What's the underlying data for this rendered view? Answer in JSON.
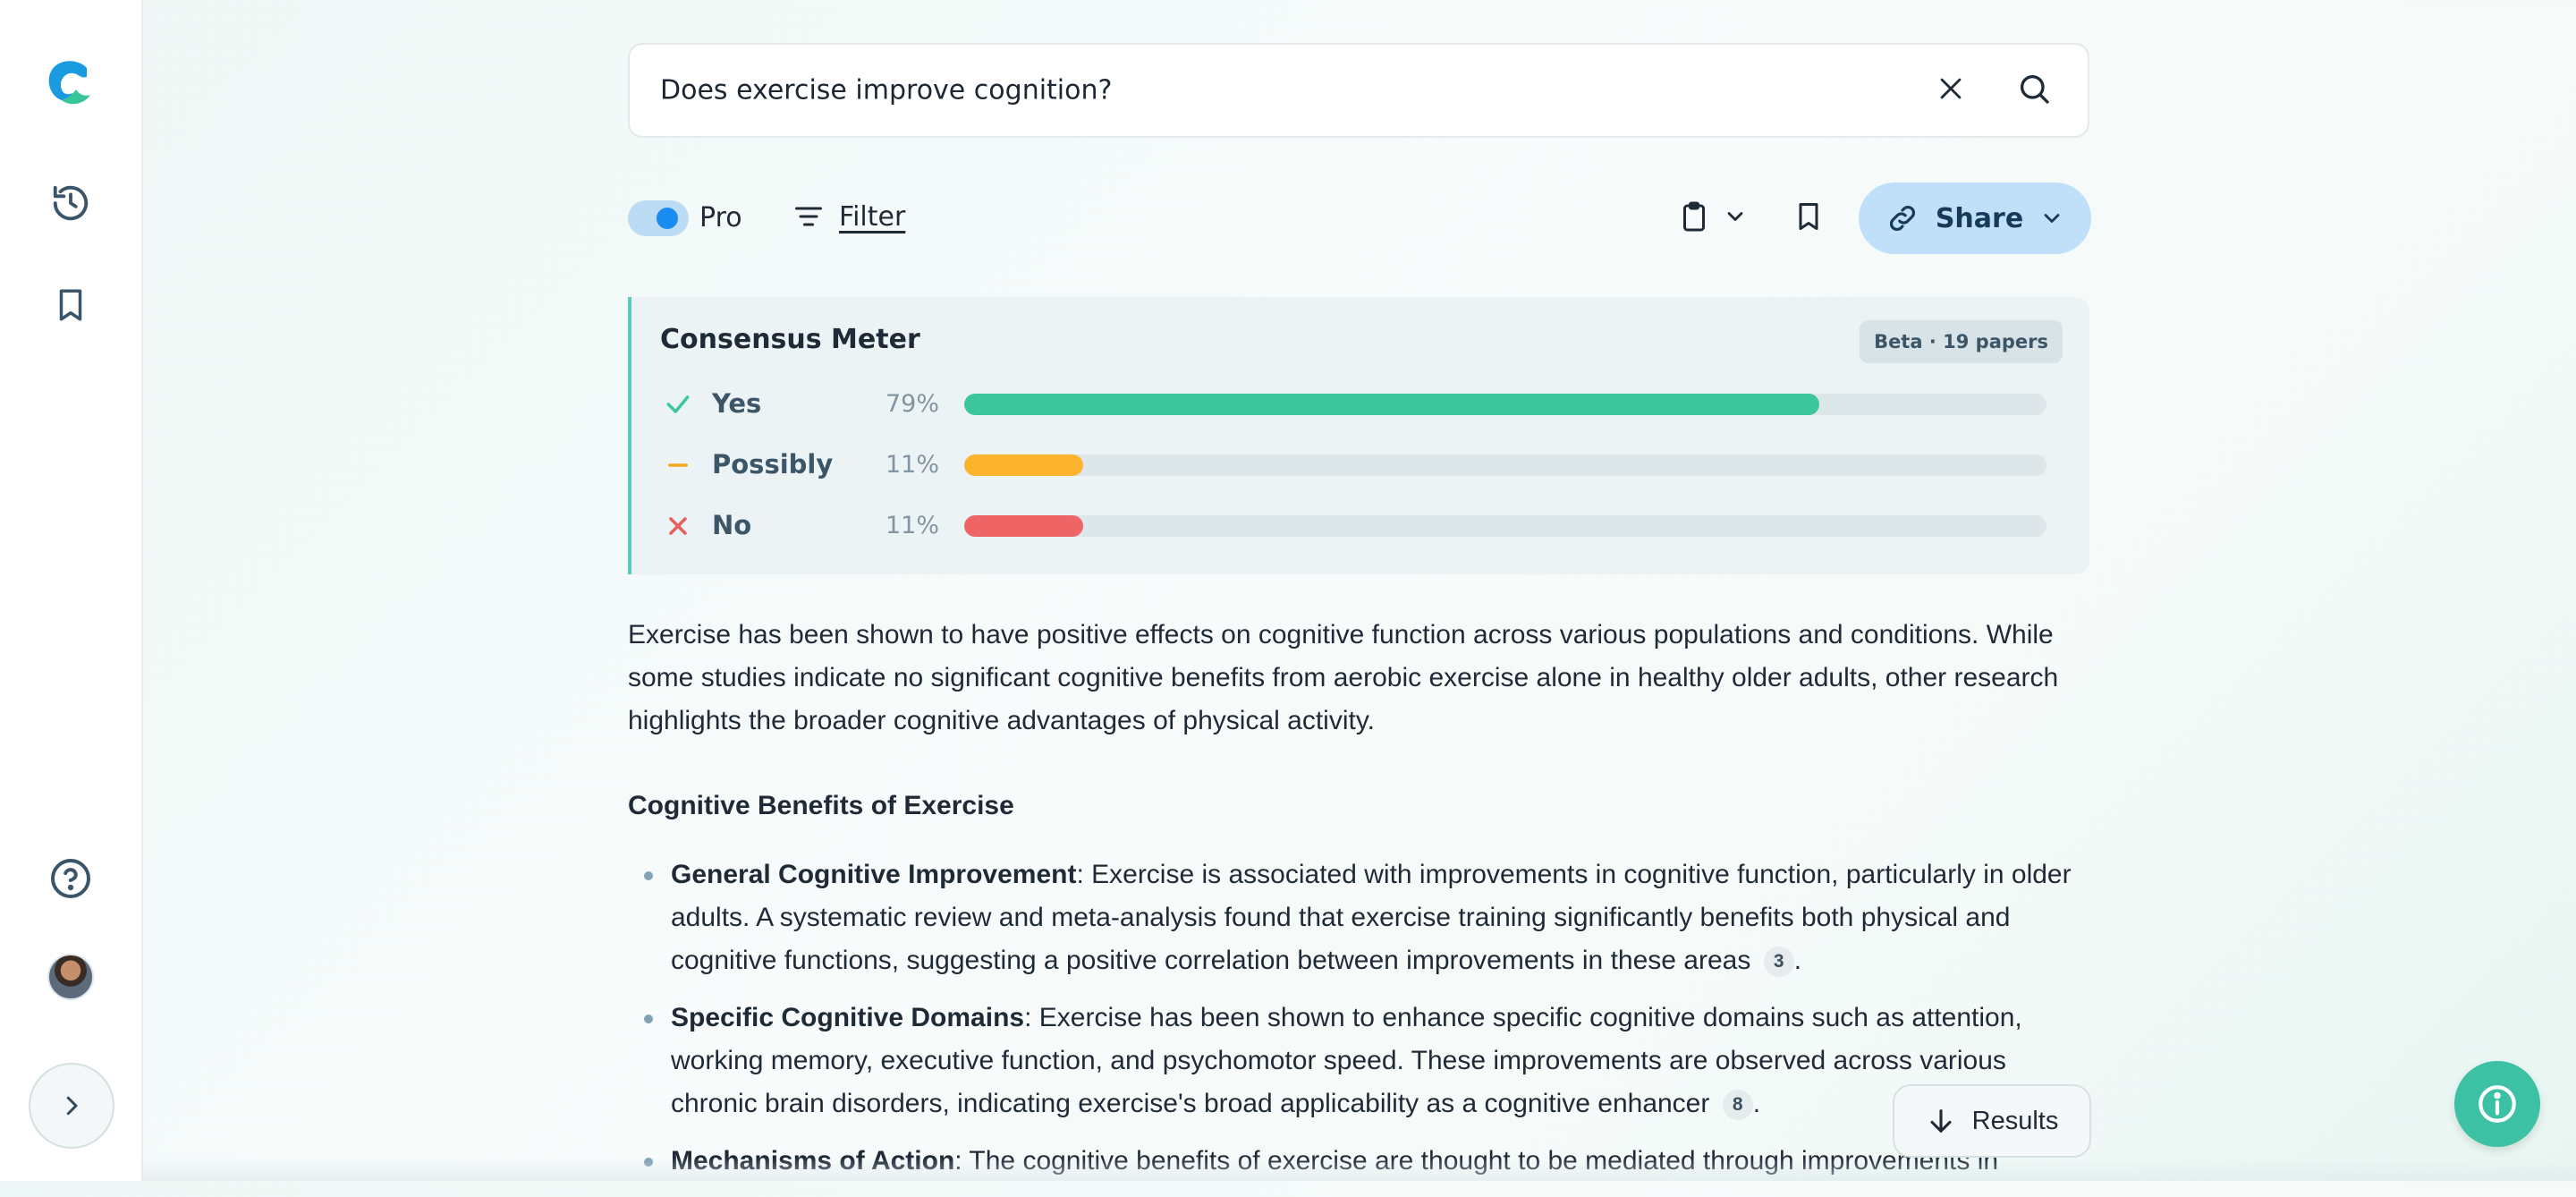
{
  "search": {
    "query": "Does exercise improve cognition?"
  },
  "toolbar": {
    "pro_label": "Pro",
    "pro_enabled": true,
    "filter_label": "Filter",
    "share_label": "Share"
  },
  "meter": {
    "title": "Consensus Meter",
    "badge": "Beta · 19 papers",
    "rows": [
      {
        "label": "Yes",
        "pct_text": "79%",
        "value": 79,
        "color": "#3cc79a",
        "icon": "check-icon",
        "icon_color": "#3cc79a"
      },
      {
        "label": "Possibly",
        "pct_text": "11%",
        "value": 11,
        "color": "#fbb42c",
        "icon": "dash-icon",
        "icon_color": "#f5a623"
      },
      {
        "label": "No",
        "pct_text": "11%",
        "value": 11,
        "color": "#ef6464",
        "icon": "x-icon",
        "icon_color": "#e85d5d"
      }
    ]
  },
  "summary": "Exercise has been shown to have positive effects on cognitive function across various populations and conditions. While some studies indicate no significant cognitive benefits from aerobic exercise alone in healthy older adults, other research highlights the broader cognitive advantages of physical activity.",
  "section_title": "Cognitive Benefits of Exercise",
  "bullets": [
    {
      "title": "General Cognitive Improvement",
      "text": ": Exercise is associated with improvements in cognitive function, particularly in older adults. A systematic review and meta-analysis found that exercise training significantly benefits both physical and cognitive functions, suggesting a positive correlation between improvements in these areas",
      "cite": "3",
      "end": "."
    },
    {
      "title": "Specific Cognitive Domains",
      "text": ": Exercise has been shown to enhance specific cognitive domains such as attention, working memory, executive function, and psychomotor speed. These improvements are observed across various chronic brain disorders, indicating exercise's broad applicability as a cognitive enhancer",
      "cite": "8",
      "end": "."
    },
    {
      "title": "Mechanisms of Action",
      "text": ": The cognitive benefits of exercise are thought to be mediated through improvements in",
      "cite": "",
      "end": ""
    }
  ],
  "results_label": "Results",
  "colors": {
    "accent": "#1a8cf0",
    "share_bg": "#bfe0f8",
    "fab": "#3cc1a4"
  }
}
